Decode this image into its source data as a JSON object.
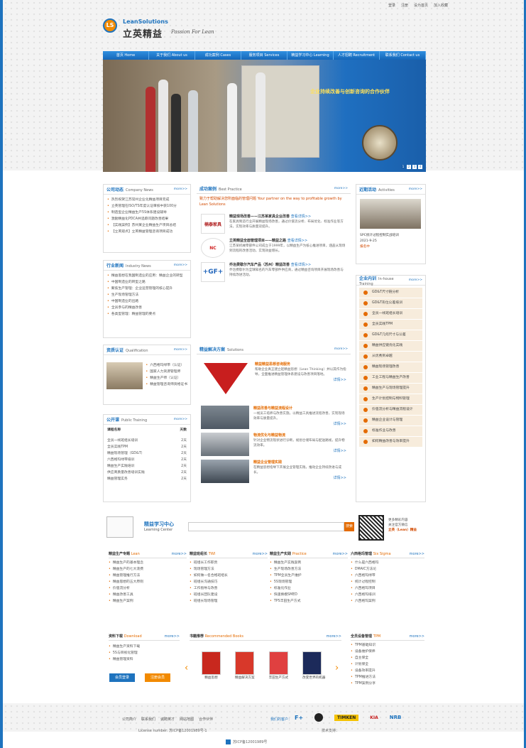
{
  "top": {
    "login": "登录",
    "register": "注册",
    "home": "设为首页",
    "fav": "加入收藏"
  },
  "logo": {
    "en": "LeanSolutions",
    "cn": "立英精益",
    "tag": "Passion For Lean",
    "mark": "LS"
  },
  "nav": [
    "首页 Home",
    "关于我们 About us",
    "成功案例 Cases",
    "服务项目 Services",
    "精益学习中心 Learning",
    "人才招聘 Recruitment",
    "联系我们 Contact us"
  ],
  "banner": {
    "slogan": "企业持续改善与创新咨询的合作伙伴",
    "pages": [
      "1",
      "2",
      "3",
      "4"
    ]
  },
  "company_news": {
    "title": "公司动态",
    "en": "Company News",
    "more": "more>>",
    "items": [
      "热烈祝贺江苏常州企业化精益项目完成",
      "立英管理在ISO/TS年度认证审核中获100分",
      "制造型企业精益生产5S体系建设辅导",
      "激励精益化PDCA并追踪问题改善结果",
      "【实践案例】苏州某企业精益生产项目总结",
      "【立英观点】立英精益管理咨询项目成功"
    ]
  },
  "industry_news": {
    "title": "行业新闻",
    "en": "Industry News",
    "more": "more>>",
    "items": [
      "精益思想在我国制造业的应用：精益企业的转型",
      "中国制造业的转型之路",
      "聚焦生产管理：企业运营管理的核心提升",
      "生产现场管理方法",
      "中国制造业的出路",
      "全员参与的精益改善",
      "各类型管理：精益管理的要点"
    ]
  },
  "qualification": {
    "title": "资质认证",
    "en": "Qualification",
    "more": "more>>",
    "items": [
      "六西格玛绿带（认证）",
      "国家人力资源管理师",
      "精益生产师（认证）",
      "精益管理咨询师资格证书"
    ]
  },
  "public_training": {
    "title": "公开课",
    "en": "Public Training",
    "more": "more>>",
    "head": [
      "课程名称",
      "天数"
    ],
    "rows": [
      [
        "全员一线班组长培训",
        "2天"
      ],
      [
        "全员实践TPM",
        "2天"
      ],
      [
        "精益现场管理（GD&T）",
        "2天"
      ],
      [
        "六西格玛绿带培训",
        "2天"
      ],
      [
        "精益生产实践培训",
        "2天"
      ],
      [
        "供应商质量改善培训实践",
        "2天"
      ],
      [
        "精益管理实务",
        "2天"
      ]
    ]
  },
  "cases": {
    "title": "成功案例",
    "en": "Best Practice",
    "more": "more>>",
    "intro": "致力于帮助解决您所面临的管理问题 Your partner on the way to profitable growth by Lean Solutions",
    "items": [
      {
        "logo": "楠泰家具",
        "title": "精益现场改善——江苏某家具企业改善",
        "link": "查看详情>>",
        "desc": "在家具制造行业开展精益现场改善，通过价值流分析、布局优化、标准作业等方法，实现效率与质量双提升。"
      },
      {
        "logo": "NC",
        "title": "立英精益全面管理项目——精益之路",
        "link": "查看详情>>",
        "desc": "江苏某机械零部件公司成立于1999年，以精益生产为核心推进项目，涵盖从现场到流程的改善活动，实现效益增长。"
      },
      {
        "logo": "+GF+",
        "title": "乔治费歇尔汽车产品（苏州）精益改善",
        "link": "查看详情>>",
        "desc": "乔治费歇尔为全球知名的汽车零部件供应商，通过精益咨询项目开展现场改善与持续改进活动。"
      }
    ]
  },
  "solutions": {
    "title": "精益解决方案",
    "en": "Solutions",
    "more": "more>>",
    "items": [
      {
        "title": "精益精益思想咨询服务",
        "desc": "帮助企业真正建立起精益思想（Lean Thinking）并以其作为指导，全面推进精益管理体系建设与改善项目落地。",
        "link": "详情>>"
      },
      {
        "title": "精益改善与精益流程设计",
        "desc": "一线员工培养与改善实施，以精益工具推进流程改善，实现现场效率与质量提升。",
        "link": "详情>>"
      },
      {
        "title": "物流优化与精益物流",
        "desc": "针对企业物流现状进行诊断，规划仓储布局与配送路线，提升物流效率。",
        "link": "详情>>"
      },
      {
        "title": "精益企业管理实践",
        "desc": "在精益思想指导下开展企业管理实践，推动企业持续改进与成长。",
        "link": "详情>>"
      }
    ]
  },
  "activities": {
    "title": "近期活动",
    "en": "Activities",
    "more": "more>>",
    "name": "SPC统计过程控制实战培训",
    "date": "2021-9-25",
    "status": "报名中"
  },
  "inhouse": {
    "title": "企业内训",
    "en": "In-house Training",
    "more": "more>>",
    "items": [
      "GD&T尺寸链分析",
      "GD&T形位公差培训",
      "全员一线班组长培训",
      "全员实践TPM",
      "GD&T几何尺寸与公差",
      "精益供应链优化实践",
      "从优秀到卓越",
      "精益现场管理改善",
      "工业工程与精益生产改善",
      "精益生产与现场管理提升",
      "生产计划控制与物料管理",
      "价值流分析与精益流程设计",
      "精益企业设计与管理",
      "标准作业与改善",
      "如何精益改善与效率提升"
    ]
  },
  "learning": {
    "title": "精益学习中心",
    "en": "Learning Center",
    "search_btn": "搜索",
    "qr_1": "更多精彩内容",
    "qr_2": "关注官方微信",
    "qr_3": "立英（Lean）精益"
  },
  "lcols": [
    {
      "title": "精益生产专题",
      "en": "Lean",
      "more": "more>>",
      "items": [
        "精益生产的基本理念",
        "精益生产的七大浪费",
        "精益管理推行方法",
        "精益思想的五大原则",
        "价值流分析",
        "精益改善工具",
        "精益生产案例"
      ]
    },
    {
      "title": "精益班组长",
      "en": "TWI",
      "more": "more>>",
      "items": [
        "班组长工作职责",
        "现场管理方法",
        "如何做一名合格班组长",
        "班组长沟通技巧",
        "工作指导与改善",
        "班组长团队建设",
        "班组长现场管理"
      ]
    },
    {
      "title": "精益生产实践",
      "en": "Practice",
      "more": "more>>",
      "items": [
        "精益生产实践案例",
        "生产现场改善方法",
        "TPM全员生产维护",
        "5S现场管理",
        "标准化作业",
        "快速换模SMED",
        "TPS丰田生产方式"
      ]
    },
    {
      "title": "六西格玛管理",
      "en": "Six Sigma",
      "more": "more>>",
      "items": [
        "什么是六西格玛",
        "DMAIC方法论",
        "六西格玛绿带",
        "统计过程控制",
        "六西格玛项目",
        "六西格玛培训",
        "六西格玛案例"
      ]
    }
  ],
  "downloads": {
    "title": "资料下载",
    "en": "Download",
    "more": "more>>",
    "items": [
      "精益生产资料下载",
      "5S与目视化管理",
      "精益管理资料"
    ],
    "btn1": "会员登录",
    "btn2": "注册会员"
  },
  "books": {
    "title": "书籍推荐",
    "en": "Recommended Books",
    "more": "more>>",
    "items": [
      "精益思想",
      "精益解决方案",
      "丰田生产方式",
      "改变世界的机器"
    ]
  },
  "tpm": {
    "title": "全员设备管理",
    "en": "TPM",
    "more": "more>>",
    "items": [
      "TPM基础知识",
      "设备维护保养",
      "自主保全",
      "计划保全",
      "设备效率提升",
      "TPM推进方法",
      "TPM案例分享"
    ]
  },
  "footer": {
    "links": [
      "公司简介",
      "联系我们",
      "诚聘英才",
      "网站地图",
      "合作伙伴"
    ],
    "partners_label": "我们的客户：",
    "license": "License number: 苏ICP备12001989号-1",
    "tech": "技术支持：",
    "icp": "苏ICP备12001989号"
  }
}
